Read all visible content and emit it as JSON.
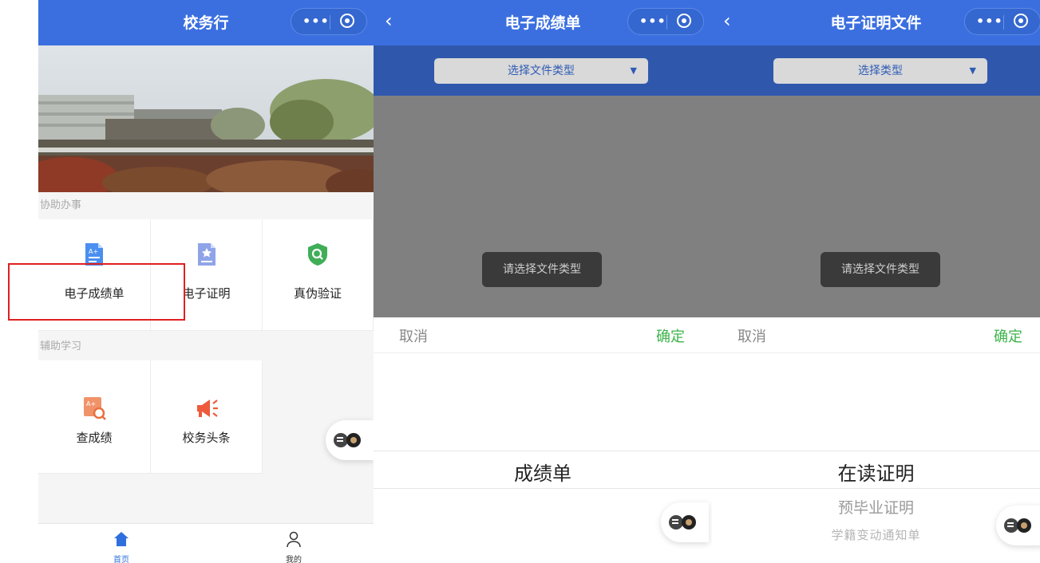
{
  "screen1": {
    "title": "校务行",
    "section1_label": "协助办事",
    "section2_label": "辅助学习",
    "items": [
      {
        "label": "电子成绩单",
        "icon": "grade-report-icon"
      },
      {
        "label": "电子证明",
        "icon": "certificate-icon"
      },
      {
        "label": "真伪验证",
        "icon": "verify-shield-icon"
      },
      {
        "label": "查成绩",
        "icon": "search-grade-icon"
      },
      {
        "label": "校务头条",
        "icon": "megaphone-icon"
      }
    ],
    "tabs": [
      {
        "label": "首页",
        "icon": "home-icon"
      },
      {
        "label": "我的",
        "icon": "user-icon"
      }
    ]
  },
  "screen2": {
    "title": "电子成绩单",
    "select_label": "选择文件类型",
    "toast": "请选择文件类型",
    "cancel": "取消",
    "confirm": "确定",
    "options": [
      "成绩单"
    ]
  },
  "screen3": {
    "title": "电子证明文件",
    "select_label": "选择类型",
    "toast": "请选择文件类型",
    "cancel": "取消",
    "confirm": "确定",
    "options": [
      "在读证明",
      "预毕业证明",
      "学籍变动通知单"
    ]
  },
  "colors": {
    "navbar": "#3b6fe0",
    "filter_bar": "#2f58ad",
    "confirm": "#3cb34a",
    "highlight_box": "#e02020"
  }
}
